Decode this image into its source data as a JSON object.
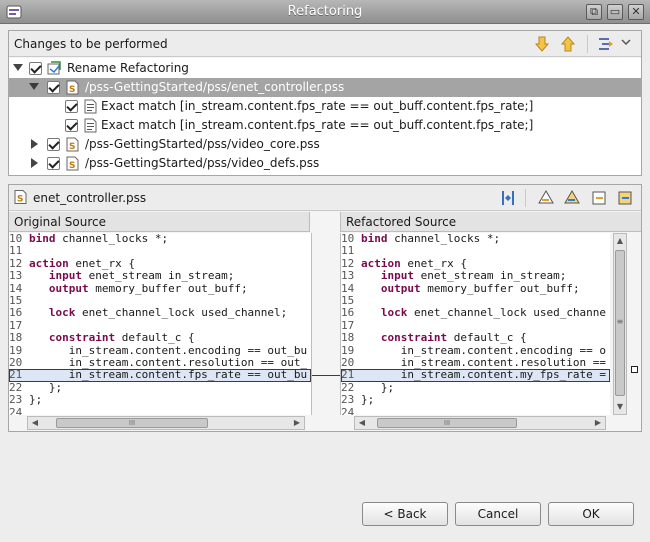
{
  "window": {
    "title": "Refactoring",
    "controls": [
      "restore-icon",
      "minimize-icon",
      "close-icon"
    ]
  },
  "changes_panel": {
    "title": "Changes to be performed",
    "toolbar_icons": [
      "next-change-icon",
      "previous-change-icon",
      "filter-icon",
      "chevron-down-icon"
    ],
    "tree": [
      {
        "label": "Rename Refactoring",
        "expanded": true,
        "checked": true,
        "icon": "refactor-icon"
      },
      {
        "label": "/pss-GettingStarted/pss/enet_controller.pss",
        "expanded": true,
        "checked": true,
        "selected": true,
        "icon": "pss-file-icon"
      },
      {
        "label": "Exact match [in_stream.content.fps_rate == out_buff.content.fps_rate;]",
        "checked": true,
        "icon": "text-edit-icon"
      },
      {
        "label": "Exact match [in_stream.content.fps_rate == out_buff.content.fps_rate;]",
        "checked": true,
        "icon": "text-edit-icon"
      },
      {
        "label": "/pss-GettingStarted/pss/video_core.pss",
        "expanded": false,
        "checked": true,
        "icon": "pss-file-icon"
      },
      {
        "label": "/pss-GettingStarted/pss/video_defs.pss",
        "expanded": false,
        "checked": true,
        "icon": "pss-file-icon"
      }
    ]
  },
  "compare_panel": {
    "file": "enet_controller.pss",
    "toolbar_icons": [
      "compare-icon",
      "copy-right-icon",
      "copy-all-right-icon",
      "copy-left-icon",
      "copy-all-left-icon"
    ],
    "original_title": "Original Source",
    "refactored_title": "Refactored Source",
    "original_lines": [
      {
        "n": "10",
        "pre": "",
        "kw": "bind",
        "rest": " channel_locks *;"
      },
      {
        "n": "11",
        "pre": "",
        "kw": "",
        "rest": ""
      },
      {
        "n": "12",
        "pre": "",
        "kw": "action",
        "rest": " enet_rx {"
      },
      {
        "n": "13",
        "pre": "   ",
        "kw": "input",
        "rest": " enet_stream in_stream;"
      },
      {
        "n": "14",
        "pre": "   ",
        "kw": "output",
        "rest": " memory_buffer out_buff;"
      },
      {
        "n": "15",
        "pre": "",
        "kw": "",
        "rest": ""
      },
      {
        "n": "16",
        "pre": "   ",
        "kw": "lock",
        "rest": " enet_channel_lock used_channel;"
      },
      {
        "n": "17",
        "pre": "",
        "kw": "",
        "rest": ""
      },
      {
        "n": "18",
        "pre": "   ",
        "kw": "constraint",
        "rest": " default_c {"
      },
      {
        "n": "19",
        "pre": "",
        "kw": "",
        "rest": "      in_stream.content.encoding == out_bu"
      },
      {
        "n": "20",
        "pre": "",
        "kw": "",
        "rest": "      in_stream.content.resolution == out_"
      },
      {
        "n": "21",
        "pre": "",
        "kw": "",
        "rest": "      in_stream.content.fps_rate == out_bu"
      },
      {
        "n": "22",
        "pre": "",
        "kw": "",
        "rest": "   };"
      },
      {
        "n": "23",
        "pre": "",
        "kw": "",
        "rest": "};"
      },
      {
        "n": "24",
        "pre": "",
        "kw": "",
        "rest": ""
      }
    ],
    "refactored_lines": [
      {
        "n": "10",
        "pre": "",
        "kw": "bind",
        "rest": " channel_locks *;"
      },
      {
        "n": "11",
        "pre": "",
        "kw": "",
        "rest": ""
      },
      {
        "n": "12",
        "pre": "",
        "kw": "action",
        "rest": " enet_rx {"
      },
      {
        "n": "13",
        "pre": "   ",
        "kw": "input",
        "rest": " enet_stream in_stream;"
      },
      {
        "n": "14",
        "pre": "   ",
        "kw": "output",
        "rest": " memory_buffer out_buff;"
      },
      {
        "n": "15",
        "pre": "",
        "kw": "",
        "rest": ""
      },
      {
        "n": "16",
        "pre": "   ",
        "kw": "lock",
        "rest": " enet_channel_lock used_channe"
      },
      {
        "n": "17",
        "pre": "",
        "kw": "",
        "rest": ""
      },
      {
        "n": "18",
        "pre": "   ",
        "kw": "constraint",
        "rest": " default_c {"
      },
      {
        "n": "19",
        "pre": "",
        "kw": "",
        "rest": "      in_stream.content.encoding == o"
      },
      {
        "n": "20",
        "pre": "",
        "kw": "",
        "rest": "      in_stream.content.resolution == "
      },
      {
        "n": "21",
        "pre": "",
        "kw": "",
        "rest": "      in_stream.content.my_fps_rate = "
      },
      {
        "n": "22",
        "pre": "",
        "kw": "",
        "rest": "   };"
      },
      {
        "n": "23",
        "pre": "",
        "kw": "",
        "rest": "};"
      },
      {
        "n": "24",
        "pre": "",
        "kw": "",
        "rest": ""
      }
    ],
    "scroll_thumb_glyph": "III",
    "vscroll_thumb_glyph": "≡"
  },
  "buttons": {
    "back": "< Back",
    "cancel": "Cancel",
    "ok": "OK"
  },
  "colors": {
    "title_bar": "#9c9c9c",
    "selection": "#a4a4a4",
    "keyword": "#7a0a4f",
    "changed_line": "#dde6f5"
  }
}
